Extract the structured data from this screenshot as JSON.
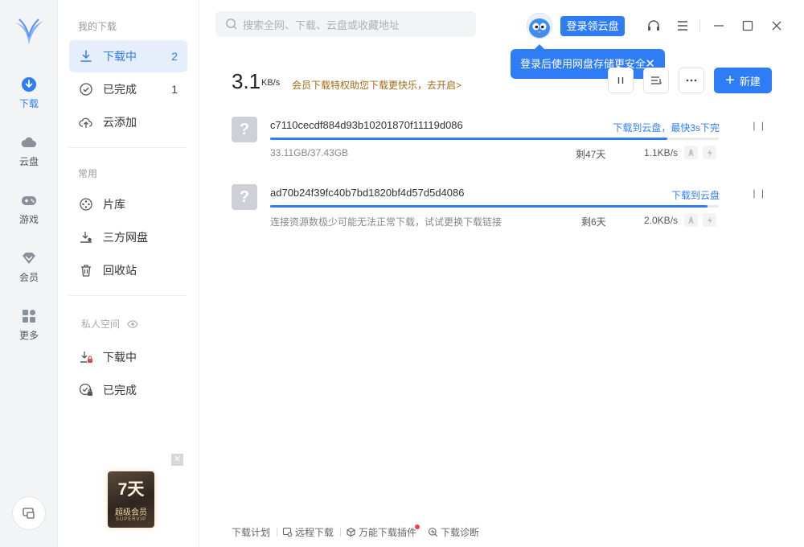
{
  "rail": {
    "items": [
      {
        "label": "下载",
        "icon": "download-icon",
        "active": true
      },
      {
        "label": "云盘",
        "icon": "cloud-icon"
      },
      {
        "label": "游戏",
        "icon": "gamepad-icon"
      },
      {
        "label": "会员",
        "icon": "diamond-icon"
      },
      {
        "label": "更多",
        "icon": "grid-icon"
      }
    ]
  },
  "sidebar": {
    "my_downloads_title": "我的下载",
    "items": [
      {
        "label": "下载中",
        "count": "2",
        "icon": "download-icon"
      },
      {
        "label": "已完成",
        "count": "1",
        "icon": "check-circle-icon"
      },
      {
        "label": "云添加",
        "icon": "cloud-upload-icon"
      }
    ],
    "common_title": "常用",
    "common_items": [
      {
        "label": "片库",
        "icon": "film-reel-icon"
      },
      {
        "label": "三方网盘",
        "icon": "download-drive-icon"
      },
      {
        "label": "回收站",
        "icon": "trash-icon"
      }
    ],
    "private_title": "私人空间",
    "private_items": [
      {
        "label": "下载中",
        "icon": "lock-download-icon"
      },
      {
        "label": "已完成",
        "icon": "lock-check-icon"
      }
    ],
    "promo": {
      "big": "7天",
      "mid": "超级会员",
      "small": "SUPERVIP"
    }
  },
  "topbar": {
    "search_placeholder": "搜索全网、下载、云盘或收藏地址",
    "login_button": "登录领云盘",
    "tooltip": "登录后使用网盘存储更安全"
  },
  "header": {
    "speed": "3.1",
    "speed_unit": "KB/s",
    "promo_text": "会员下载特权助您下载更快乐，去开启>",
    "new_button": "新建"
  },
  "tasks": [
    {
      "name": "c7110cecdf884d93b10201870f11119d086",
      "link": "下载到云盘，最快3s下完",
      "progress": 0.885,
      "sub": "33.11GB/37.43GB",
      "remain": "剩47天",
      "speed": "1.1KB/s"
    },
    {
      "name": "ad70b24f39fc40b7bd1820bf4d57d5d4086",
      "link": "下载到云盘",
      "progress": 0.975,
      "sub": "连接资源数极少可能无法正常下载，试试更换下载链接",
      "remain": "剩6天",
      "speed": "2.0KB/s"
    }
  ],
  "footer": {
    "items": [
      "下载计划",
      "远程下载",
      "万能下载插件",
      "下载诊断"
    ]
  },
  "colors": {
    "accent": "#2f7df6",
    "promo_text": "#a06b17",
    "badge_dot": "#f04444"
  }
}
